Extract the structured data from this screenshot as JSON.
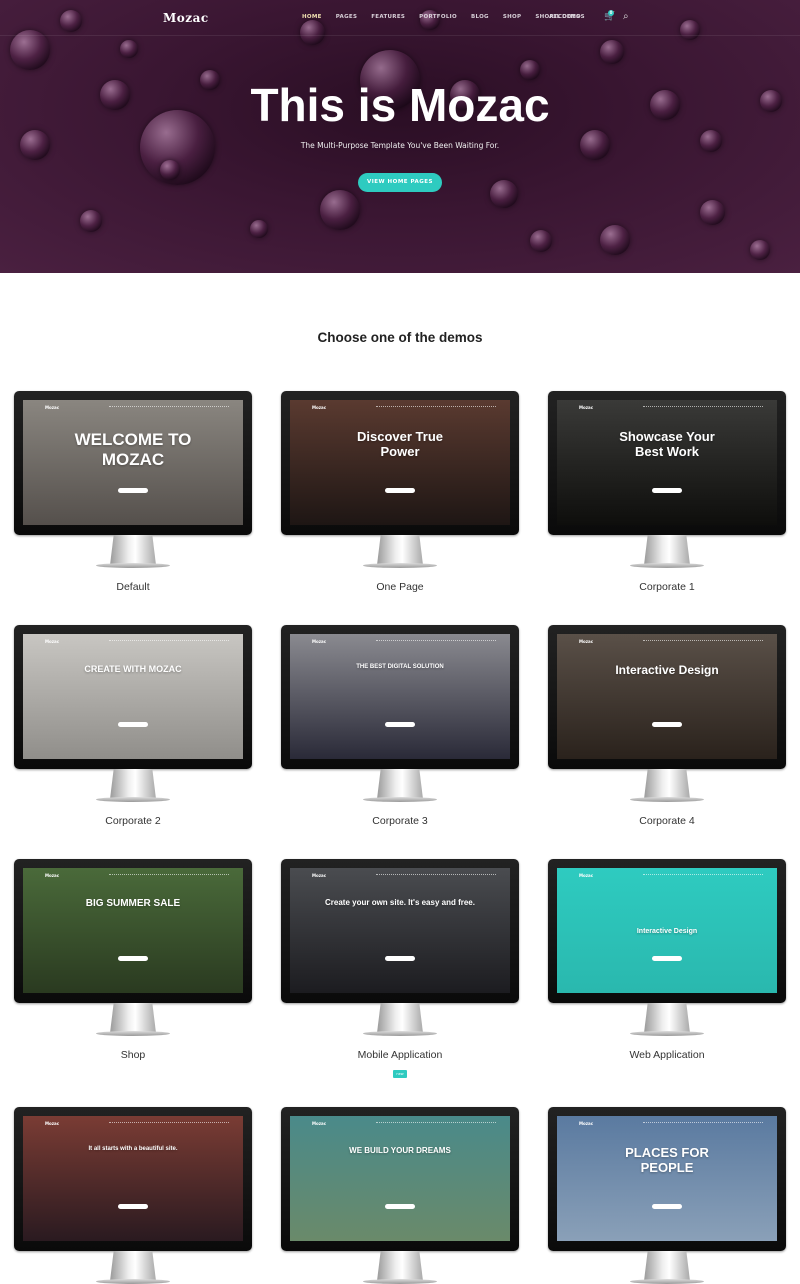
{
  "nav": {
    "logo": "Mozac",
    "items": [
      "HOME",
      "PAGES",
      "FEATURES",
      "PORTFOLIO",
      "BLOG",
      "SHOP",
      "SHORTCODES"
    ],
    "all_demos": "ALL DEMOS",
    "cart_count": "0",
    "accent": "#2ecbc0"
  },
  "hero": {
    "title": "This is Mozac",
    "subtitle": "The Multi-Purpose Template You've Been Waiting For.",
    "cta": "VIEW HOME PAGES"
  },
  "section_title": "Choose one of the demos",
  "demos": [
    {
      "label": "Default",
      "headline": "WELCOME TO MOZAC",
      "bg": [
        "#8a8680",
        "#55504c"
      ],
      "size": 17
    },
    {
      "label": "One Page",
      "headline": "Discover True Power",
      "bg": [
        "#5a3a30",
        "#1e1614"
      ],
      "size": 13
    },
    {
      "label": "Corporate 1",
      "headline": "Showcase Your Best Work",
      "bg": [
        "#3a3a38",
        "#0e0e0c"
      ],
      "size": 13
    },
    {
      "label": "Corporate 2",
      "headline": "CREATE WITH MOZAC",
      "bg": [
        "#c8c6c2",
        "#908e8a"
      ],
      "size": 9
    },
    {
      "label": "Corporate 3",
      "headline": "THE BEST DIGITAL SOLUTION",
      "bg": [
        "#8a8a90",
        "#2a2a38"
      ],
      "size": 6
    },
    {
      "label": "Corporate 4",
      "headline": "Interactive Design",
      "bg": [
        "#5a5048",
        "#2a221c"
      ],
      "size": 12
    },
    {
      "label": "Shop",
      "headline": "BIG SUMMER SALE",
      "bg": [
        "#4a6a3a",
        "#2a3a20"
      ],
      "size": 10
    },
    {
      "label": "Mobile Application",
      "headline": "Create your own site. It's easy and free.",
      "bg": [
        "#4a4c50",
        "#1c1c20"
      ],
      "size": 8,
      "badge": "new"
    },
    {
      "label": "Web Application",
      "headline": "Interactive Design",
      "bg": [
        "#2ecbc0",
        "#2ab8ae"
      ],
      "size": 7
    },
    {
      "label": "",
      "headline": "It all starts with a beautiful site.",
      "bg": [
        "#7a3c34",
        "#2a1a20"
      ],
      "size": 6
    },
    {
      "label": "",
      "headline": "WE BUILD YOUR DREAMS",
      "bg": [
        "#4a8a8a",
        "#6a8a6a"
      ],
      "size": 8
    },
    {
      "label": "",
      "headline": "PLACES FOR PEOPLE",
      "bg": [
        "#5a7aa0",
        "#8aa0b8"
      ],
      "size": 13
    }
  ]
}
